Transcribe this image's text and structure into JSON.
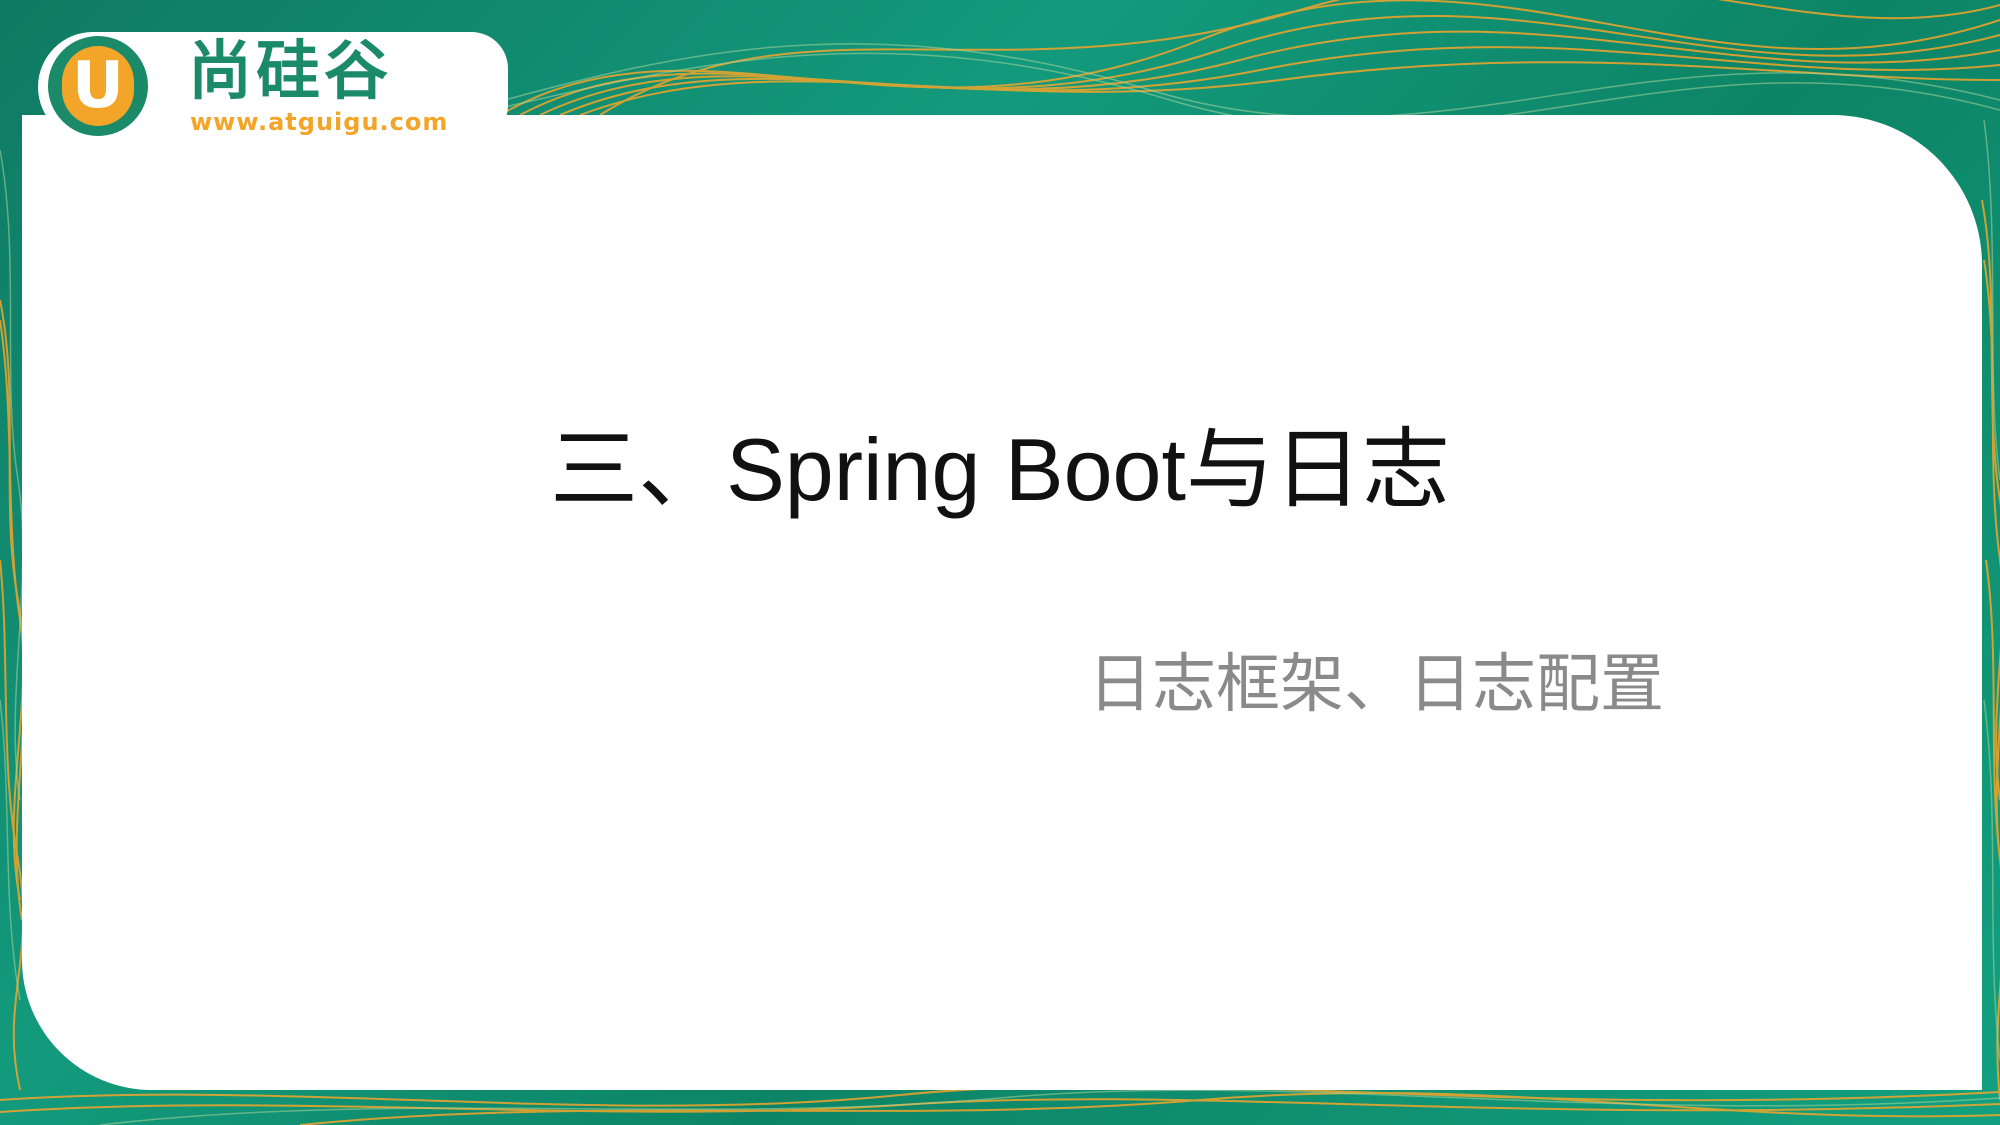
{
  "logo": {
    "mark": "U",
    "name": "尚硅谷",
    "url": "www.atguigu.com"
  },
  "slide": {
    "title": "三、Spring Boot与日志",
    "subtitle": "日志框架、日志配置"
  },
  "colors": {
    "background_green": "#0f7a63",
    "accent_orange": "#f3a52a",
    "card": "#ffffff",
    "title_text": "#111111",
    "subtitle_text": "#8a8a8a"
  }
}
